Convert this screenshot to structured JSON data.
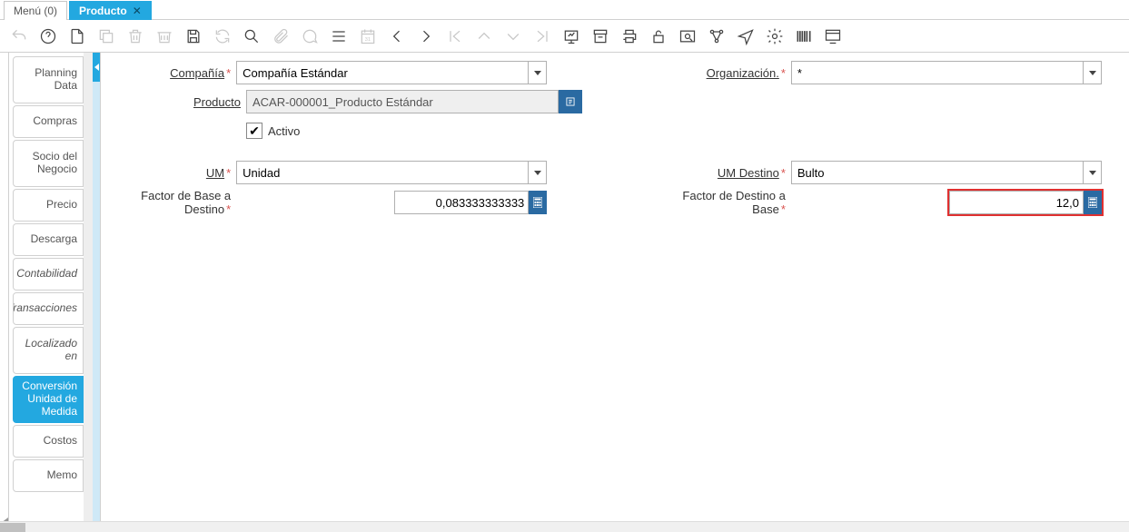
{
  "tabs": {
    "menu": {
      "label": "Menú (0)"
    },
    "product": {
      "label": "Producto"
    }
  },
  "sidebar": [
    {
      "label": "Planning Data",
      "active": false,
      "tall": true
    },
    {
      "label": "Compras",
      "active": false,
      "tall": false
    },
    {
      "label": "Socio del Negocio",
      "active": false,
      "tall": true
    },
    {
      "label": "Precio",
      "active": false,
      "tall": false
    },
    {
      "label": "Descarga",
      "active": false,
      "tall": false
    },
    {
      "label": "Contabilidad",
      "active": false,
      "tall": false,
      "italic": true
    },
    {
      "label": "Transacciones",
      "active": false,
      "tall": false,
      "italic": true
    },
    {
      "label": "Localizado en",
      "active": false,
      "tall": true,
      "italic": true
    },
    {
      "label": "Conversión Unidad de Medida",
      "active": true,
      "tall": true
    },
    {
      "label": "Costos",
      "active": false,
      "tall": false
    },
    {
      "label": "Memo",
      "active": false,
      "tall": false
    }
  ],
  "form": {
    "compania": {
      "label": "Compañía",
      "value": "Compañía Estándar"
    },
    "organizacion": {
      "label": "Organización.",
      "value": "*"
    },
    "producto": {
      "label": "Producto",
      "value": "ACAR-000001_Producto Estándar"
    },
    "activo": {
      "label": "Activo",
      "checked": true
    },
    "um": {
      "label": "UM",
      "value": "Unidad"
    },
    "um_destino": {
      "label": "UM Destino",
      "value": "Bulto"
    },
    "factor_bd": {
      "label": "Factor de Base a Destino",
      "value": "0,083333333333"
    },
    "factor_db": {
      "label": "Factor de Destino a Base",
      "value": "12,0"
    }
  }
}
